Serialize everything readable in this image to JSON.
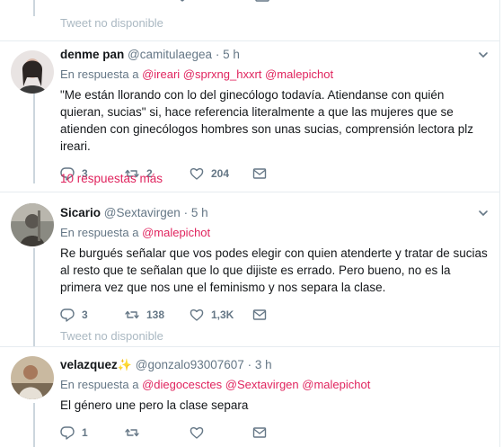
{
  "colors": {
    "accent": "#e0245e",
    "muted": "#657786",
    "divider": "#e6ecf0",
    "unavailable": "#aab8c2"
  },
  "top": {
    "unavailable": "Tweet no disponible"
  },
  "tweet1": {
    "name": "denme pan",
    "handle": "@camitulaegea",
    "dot": "·",
    "time": "5 h",
    "reply_prefix": "En respuesta a",
    "mentions": [
      "@ireari",
      "@sprxng_hxxrt",
      "@malepichot"
    ],
    "text": "\"Me están llorando con lo del ginecólogo todavía. Atiendanse con quién quieran, sucias\" si, hace referencia literalmente a que las mujeres que se atienden con ginecólogos hombres son unas sucias, comprensión lectora plz ireari.",
    "replies": "3",
    "retweets": "2",
    "likes": "204",
    "more_replies": "10 respuestas más"
  },
  "tweet2": {
    "name": "Sicario",
    "handle": "@Sextavirgen",
    "dot": "·",
    "time": "5 h",
    "reply_prefix": "En respuesta a",
    "mentions": [
      "@malepichot"
    ],
    "text": "Re burgués señalar que vos podes elegir con quien atenderte y tratar de sucias al resto que te señalan que lo que dijiste es errado. Pero bueno, no es la primera vez que nos une el feminismo y nos separa la clase.",
    "replies": "3",
    "retweets": "138",
    "likes": "1,3K",
    "unavailable": "Tweet no disponible"
  },
  "tweet3": {
    "name": "velazquez",
    "name_emoji": "✨",
    "handle": "@gonzalo93007607",
    "dot": "·",
    "time": "3 h",
    "reply_prefix": "En respuesta a",
    "mentions": [
      "@diegocesctes",
      "@Sextavirgen",
      "@malepichot"
    ],
    "text": "El género une pero la clase separa",
    "replies": "1",
    "retweets": "",
    "likes": ""
  },
  "icons": {
    "reply": "reply-icon",
    "retweet": "retweet-icon",
    "like": "heart-icon",
    "dm": "envelope-icon",
    "more": "chevron-down-icon"
  }
}
